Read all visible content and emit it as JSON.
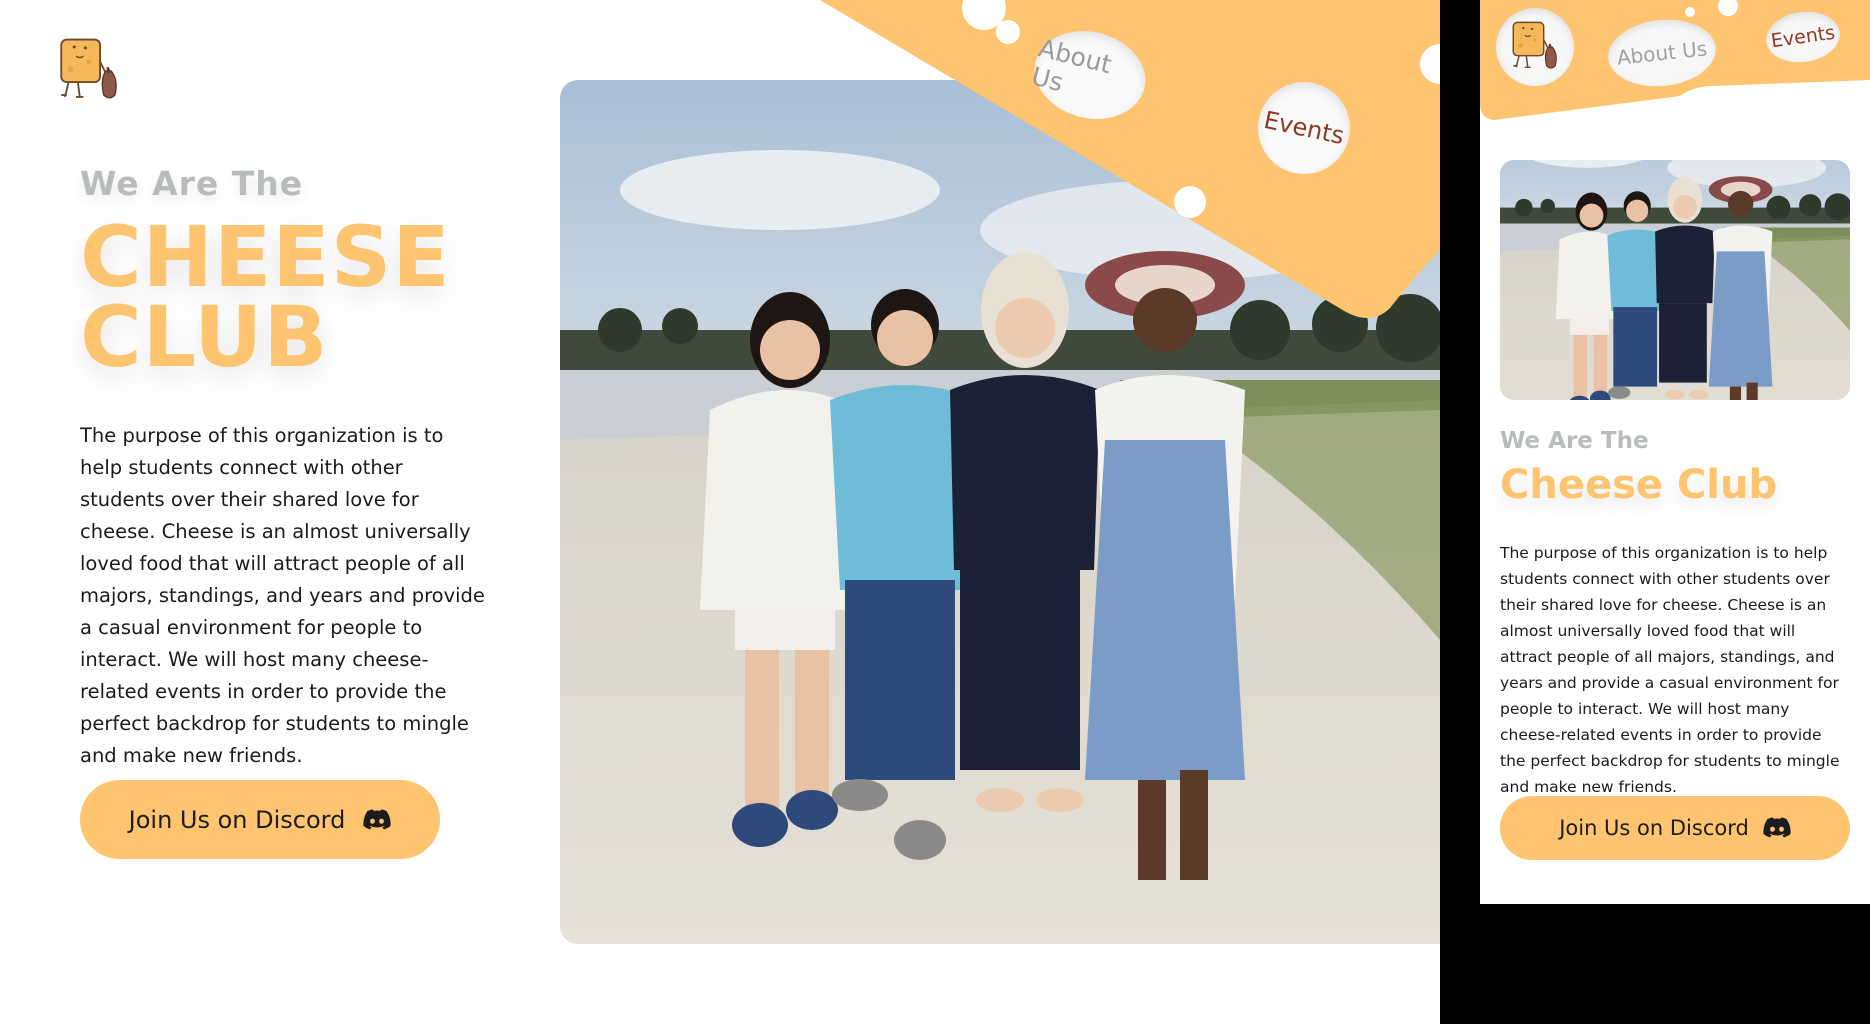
{
  "brand": {
    "accent": "#fec46f",
    "eyebrow_color": "#b9bcbd",
    "nav_event_color": "#8a3b22"
  },
  "desktop": {
    "logo": "cheese-mascot-icon",
    "nav": {
      "about": "About Us",
      "events": "Events"
    },
    "hero": {
      "eyebrow": "We Are The",
      "title_line1": "CHEESE",
      "title_line2": "CLUB",
      "description": "The purpose of this organization is to help students connect with other students over their shared love for cheese. Cheese is an almost universally loved food that will attract people of all majors, standings, and years and provide a casual environment for people to interact. We will host many cheese-related events in order to provide the perfect backdrop for students to mingle and make new friends.",
      "cta": "Join Us on Discord",
      "cta_icon": "discord-icon"
    },
    "photo": "group-photo-beach"
  },
  "mobile": {
    "logo": "cheese-mascot-icon",
    "nav": {
      "about": "About Us",
      "events": "Events"
    },
    "eyebrow": "We Are The",
    "title": "Cheese Club",
    "description": "The purpose of this organization is to help students connect with other students over their shared love for cheese. Cheese is an almost universally loved food that will attract people of all majors, standings, and years and provide a casual environment for people to interact. We will host many cheese-related events in order to provide the perfect backdrop for students to mingle and make new friends.",
    "cta": "Join Us on Discord",
    "cta_icon": "discord-icon",
    "photo": "group-photo-beach"
  }
}
